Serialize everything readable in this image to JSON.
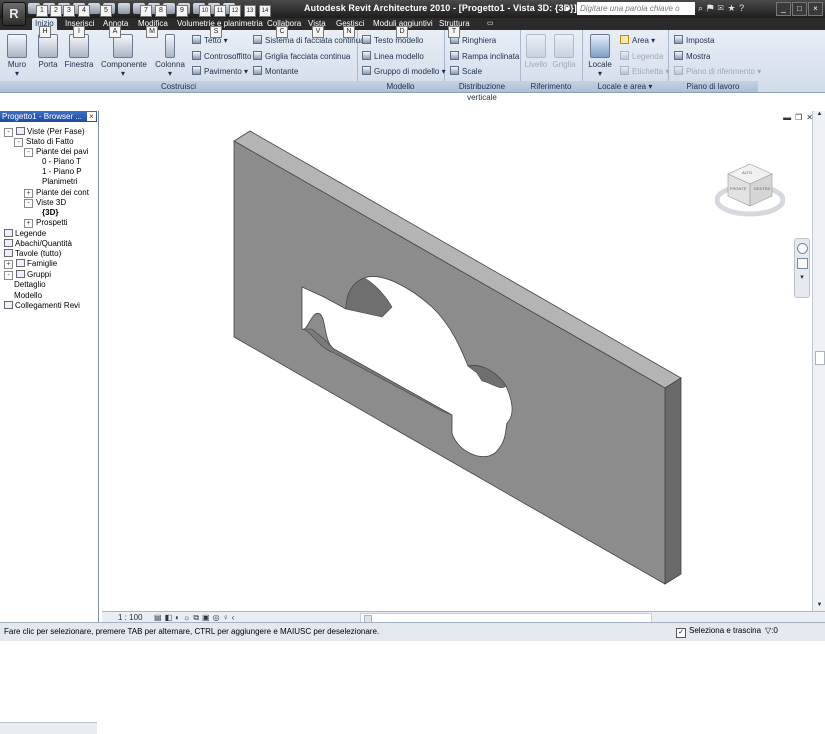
{
  "app": {
    "logo_letter": "R",
    "title": "Autodesk Revit Architecture 2010 - [Progetto1 - Vista 3D: {3D}]",
    "search_placeholder": "Digitare una parola chiave o una frase",
    "window_buttons": [
      "_",
      "□",
      "×"
    ]
  },
  "keytips": [
    "A",
    "H",
    "I",
    "T",
    "M",
    "S",
    "C",
    "V",
    "N",
    "D",
    "1",
    "2",
    "3",
    "4",
    "5",
    "6",
    "7",
    "8",
    "9",
    "10",
    "11",
    "12",
    "13",
    "14"
  ],
  "tabs": [
    "Inizio",
    "Inserisci",
    "Annota",
    "Modifica",
    "Volumetrie e planimetria",
    "Collabora",
    "Vista",
    "Gestisci",
    "Moduli aggiuntivi",
    "Struttura"
  ],
  "ribbon": {
    "panels": {
      "costruisci": "Costruisci",
      "modello": "Modello",
      "distribuzione": "Distribuzione verticale",
      "riferimento": "Riferimento",
      "locale_area": "Locale e area",
      "piano_lavoro": "Piano di lavoro"
    },
    "buttons": {
      "muro": "Muro",
      "porta": "Porta",
      "finestra": "Finestra",
      "componente": "Componente",
      "colonna": "Colonna",
      "tetto": "Tetto",
      "controsoffitto": "Controsoffitto",
      "pavimento": "Pavimento",
      "sistema_facciata": "Sistema di facciata continua",
      "griglia_facciata": "Griglia facciata continua",
      "montante": "Montante",
      "testo_modello": "Testo modello",
      "linea_modello": "Linea modello",
      "gruppo_modello": "Gruppo di modello",
      "ringhiera": "Ringhiera",
      "rampa": "Rampa inclinata",
      "scale": "Scale",
      "livello": "Livello",
      "griglia": "Griglia",
      "locale": "Locale",
      "area": "Area",
      "legenda": "Legenda",
      "etichetta": "Etichetta",
      "imposta": "Imposta",
      "mostra": "Mostra",
      "piano_riferimento": "Piano di riferimento"
    }
  },
  "browser": {
    "title": "Progetto1 - Browser ...",
    "items": [
      {
        "label": "Viste (Per Fase)",
        "exp": "-"
      },
      {
        "label": "Stato di Fatto",
        "exp": "-"
      },
      {
        "label": "Piante dei pavi",
        "exp": "-"
      },
      {
        "label": "0 - Piano T",
        "exp": ""
      },
      {
        "label": "1 - Piano P",
        "exp": ""
      },
      {
        "label": "Planimetri",
        "exp": ""
      },
      {
        "label": "Piante dei cont",
        "exp": "+"
      },
      {
        "label": "Viste 3D",
        "exp": "-"
      },
      {
        "label": "{3D}",
        "exp": ""
      },
      {
        "label": "Prospetti",
        "exp": "+"
      },
      {
        "label": "Legende",
        "exp": ""
      },
      {
        "label": "Abachi/Quantità",
        "exp": ""
      },
      {
        "label": "Tavole (tutto)",
        "exp": ""
      },
      {
        "label": "Famiglie",
        "exp": "+"
      },
      {
        "label": "Gruppi",
        "exp": "-"
      },
      {
        "label": "Dettaglio",
        "exp": ""
      },
      {
        "label": "Modello",
        "exp": ""
      },
      {
        "label": "Collegamenti Revi",
        "exp": ""
      }
    ]
  },
  "viewcube": {
    "front": "FRONTE",
    "right": "DESTRA",
    "top": "ALTO"
  },
  "view": {
    "scale": "1 : 100"
  },
  "status": {
    "text": "Fare clic per selezionare, premere TAB per alternare, CTRL per aggiungere e MAIUSC per deselezionare.",
    "drag_label": "Seleziona e trascina",
    "filter_count": ":0"
  },
  "colors": {
    "wall_face": "#8b8b8b",
    "wall_top": "#b3b3b3",
    "wall_side": "#6a6a6a",
    "accent": "#2b5cb8"
  }
}
